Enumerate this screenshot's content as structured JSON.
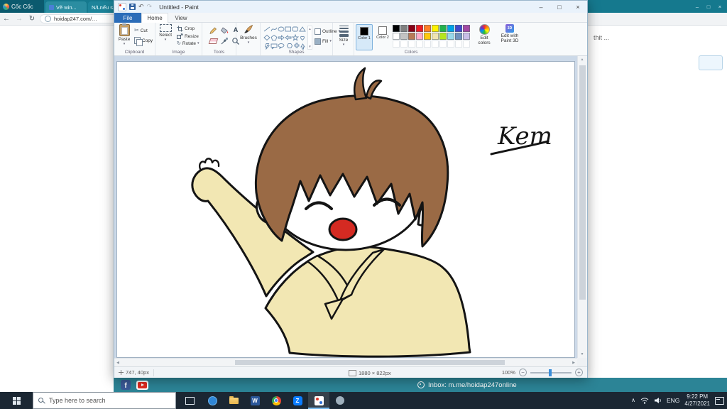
{
  "icons": {
    "back": "←",
    "forward": "→",
    "reload": "↻",
    "dropdown": "▾",
    "minimize": "–",
    "maximize": "□",
    "close": "×",
    "undo": "↶",
    "redo": "↷",
    "cut_glyph": "✂",
    "rotate_glyph": "↻",
    "scroll_up": "▲",
    "scroll_down": "▼",
    "scroll_left": "◀",
    "scroll_right": "▶",
    "chevron_up": "∧",
    "zoom_out": "−",
    "zoom_in": "+",
    "text_tool": "A",
    "fb_letter": "f",
    "word_letter": "W",
    "zalo_letter": "Z",
    "paint3d_letter": "3D"
  },
  "browser": {
    "brand": "Cốc Cốc",
    "tabs": [
      {
        "label": "Vẽ win..."
      },
      {
        "label": "N/Lnếu s..."
      }
    ],
    "address": "hoidap247.com/…",
    "page_right_text": "thit ...",
    "footer_inbox": "Inbox: m.me/hoidap247online"
  },
  "paint": {
    "title": "Untitled - Paint",
    "tabs": {
      "file": "File",
      "home": "Home",
      "view": "View"
    },
    "clipboard": {
      "label": "Clipboard",
      "paste": "Paste",
      "cut": "Cut",
      "copy": "Copy"
    },
    "image": {
      "label": "Image",
      "select": "Select",
      "crop": "Crop",
      "resize": "Resize",
      "rotate": "Rotate"
    },
    "tools_label": "Tools",
    "brushes_label": "Brushes",
    "shapes": {
      "label": "Shapes",
      "outline": "Outline",
      "fill": "Fill"
    },
    "size_label": "Size",
    "colors": {
      "label": "Colors",
      "color1": "Color 1",
      "color2": "Color 2",
      "edit": "Edit colors",
      "edit3d": "Edit with Paint 3D",
      "row1": [
        "#000000",
        "#7f7f7f",
        "#880015",
        "#ed1c24",
        "#ff7f27",
        "#fff200",
        "#22b14c",
        "#00a2e8",
        "#3f48cc",
        "#a349a4"
      ],
      "row2": [
        "#ffffff",
        "#c3c3c3",
        "#b97a57",
        "#ffaec9",
        "#ffc90e",
        "#efe4b0",
        "#b5e61d",
        "#99d9ea",
        "#7092be",
        "#c8bfe7"
      ],
      "row3": [
        "",
        "",
        "",
        "",
        "",
        "",
        "",
        "",
        "",
        ""
      ]
    },
    "status": {
      "coords": "747, 40px",
      "dimensions": "1880 × 822px",
      "zoom": "100%"
    },
    "signature": "Kem"
  },
  "taskbar": {
    "search": "Type here to search",
    "lang": "ENG",
    "time": "9:22 PM",
    "date": "4/27/2021"
  }
}
